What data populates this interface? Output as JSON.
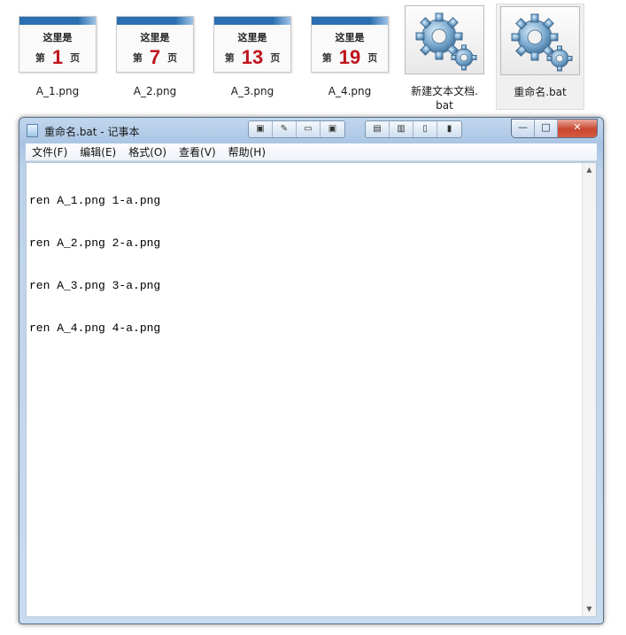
{
  "files": [
    {
      "label": "A_1.png",
      "thumb_title": "这里是",
      "page_prefix": "第",
      "page_number": "1",
      "page_suffix": "页"
    },
    {
      "label": "A_2.png",
      "thumb_title": "这里是",
      "page_prefix": "第",
      "page_number": "7",
      "page_suffix": "页"
    },
    {
      "label": "A_3.png",
      "thumb_title": "这里是",
      "page_prefix": "第",
      "page_number": "13",
      "page_suffix": "页"
    },
    {
      "label": "A_4.png",
      "thumb_title": "这里是",
      "page_prefix": "第",
      "page_number": "19",
      "page_suffix": "页"
    },
    {
      "label_line1": "新建文本文档.",
      "label_line2": "bat",
      "icon": "batch-gears-icon"
    },
    {
      "label": "重命名.bat",
      "icon": "batch-gears-icon",
      "selected": true
    }
  ],
  "window": {
    "title": "重命名.bat - 记事本",
    "controls": {
      "minimize": "—",
      "maximize": "□",
      "close": "✕"
    }
  },
  "menu": [
    "文件(F)",
    "编辑(E)",
    "格式(O)",
    "查看(V)",
    "帮助(H)"
  ],
  "editor": {
    "lines": [
      "ren A_1.png 1-a.png",
      "ren A_2.png 2-a.png",
      "ren A_3.png 3-a.png",
      "ren A_4.png 4-a.png"
    ]
  },
  "colors": {
    "accent_blue": "#2a6fb2",
    "page_number_red": "#c0141c",
    "close_red": "#c9462f"
  }
}
